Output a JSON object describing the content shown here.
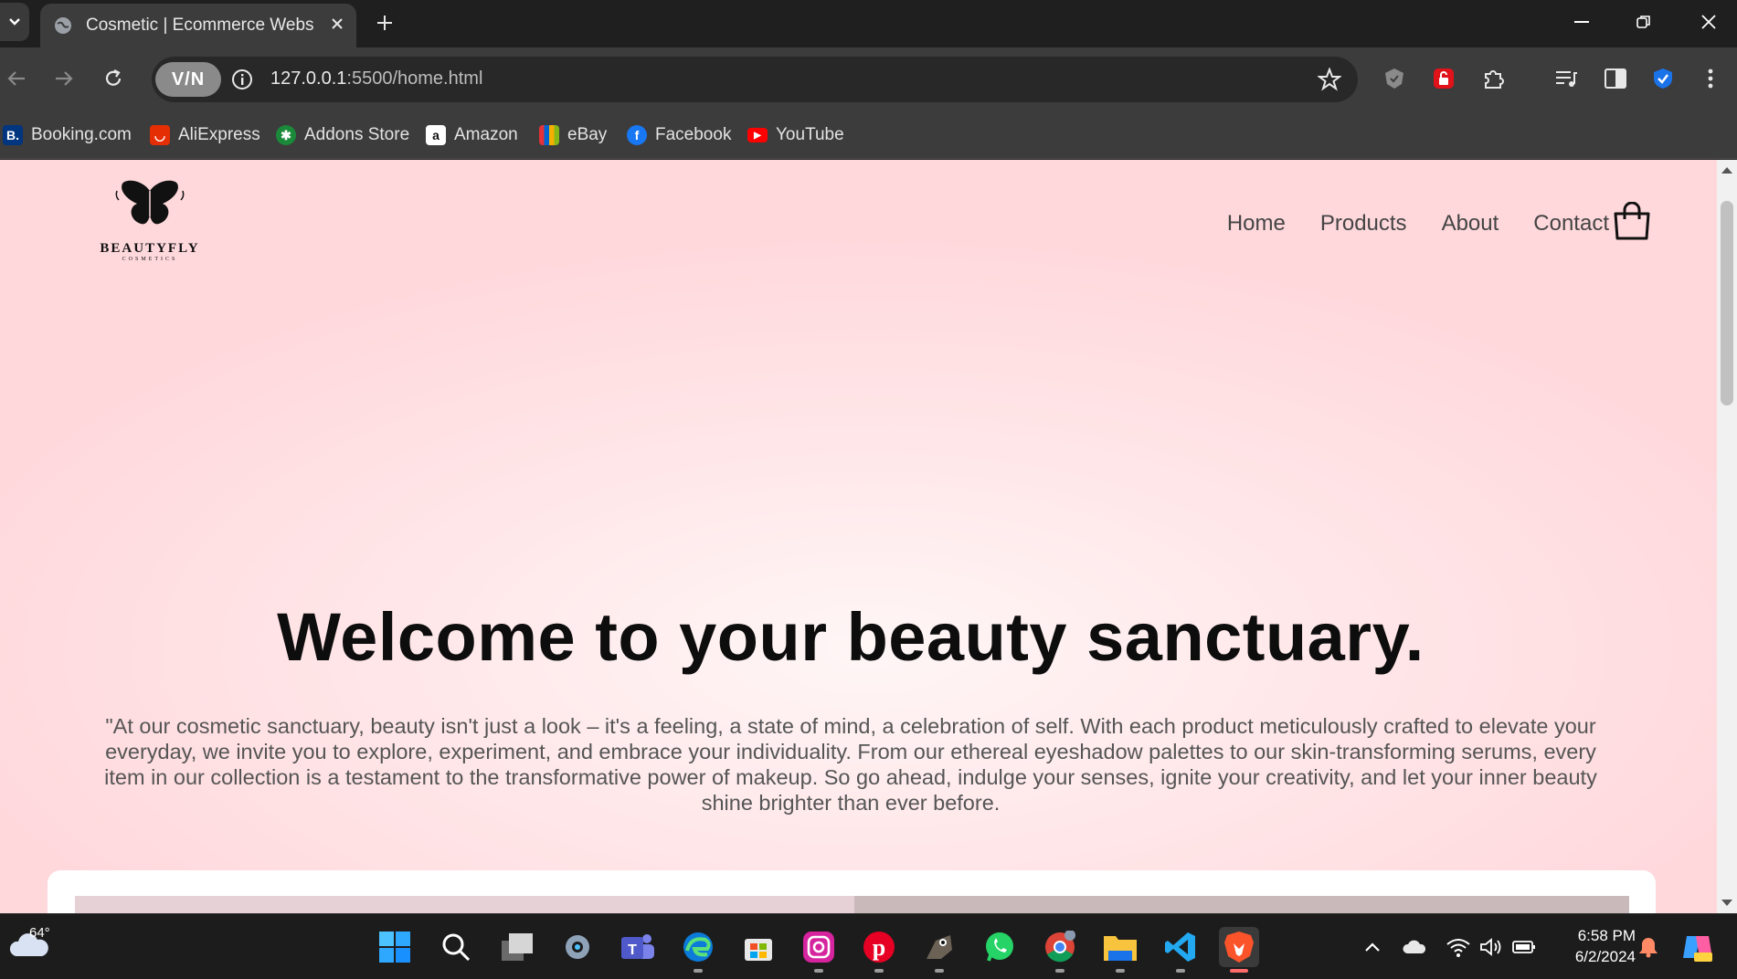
{
  "browser": {
    "tab_title": "Cosmetic | Ecommerce Website",
    "url_host": "127.0.0.1",
    "url_path": ":5500/home.html",
    "vpn_label": "V/N"
  },
  "bookmarks": [
    {
      "label": "Booking.com",
      "icon": "booking-icon",
      "color": "#003580",
      "glyph": "B."
    },
    {
      "label": "AliExpress",
      "icon": "aliexpress-icon",
      "color": "#e62e04",
      "glyph": "◡"
    },
    {
      "label": "Addons Store",
      "icon": "addons-store-icon",
      "color": "#1a8a3a",
      "glyph": "✱"
    },
    {
      "label": "Amazon",
      "icon": "amazon-icon",
      "color": "#ffffff",
      "glyph": "a"
    },
    {
      "label": "eBay",
      "icon": "ebay-icon",
      "color": "#f5af02",
      "glyph": "▀"
    },
    {
      "label": "Facebook",
      "icon": "facebook-icon",
      "color": "#1877f2",
      "glyph": "f"
    },
    {
      "label": "YouTube",
      "icon": "youtube-icon",
      "color": "#ff0000",
      "glyph": "▶"
    }
  ],
  "site": {
    "brand": "BEAUTYFLY",
    "brand_sub": "COSMETICS",
    "nav": [
      "Home",
      "Products",
      "About",
      "Contact"
    ],
    "hero_title": "Welcome to your beauty sanctuary.",
    "hero_text": "\"At our cosmetic sanctuary, beauty isn't just a look – it's a feeling, a state of mind, a celebration of self. With each product meticulously crafted to elevate your everyday, we invite you to explore, experiment, and embrace your individuality. From our ethereal eyeshadow palettes to our skin-transforming serums, every item in our collection is a testament to the transformative power of makeup. So go ahead, indulge your senses, ignite your creativity, and let your inner beauty shine brighter than ever before."
  },
  "taskbar": {
    "temperature": "64°",
    "time": "6:58 PM",
    "date": "6/2/2024",
    "apps": [
      "start-icon",
      "search-icon",
      "task-view-icon",
      "settings-icon",
      "teams-icon",
      "edge-icon",
      "store-icon",
      "instagram-icon",
      "pinterest-icon",
      "gimp-icon",
      "whatsapp-icon",
      "chrome-icon",
      "file-explorer-icon",
      "vscode-icon",
      "brave-icon"
    ]
  },
  "colors": {
    "page_bg": "#ffdfe2",
    "heading": "#0d0d0d",
    "body_text": "#555555"
  }
}
